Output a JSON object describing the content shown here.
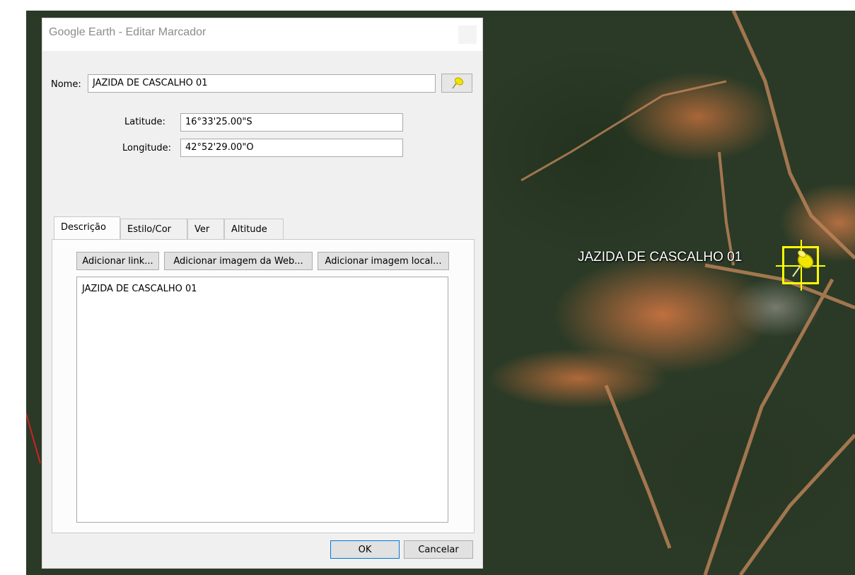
{
  "map": {
    "placemark_label": "JAZIDA DE CASCALHO 01"
  },
  "dialog": {
    "title": "Google Earth - Editar Marcador",
    "name_label": "Nome:",
    "name_value": "JAZIDA DE CASCALHO 01",
    "latitude_label": "Latitude:",
    "latitude_value": "16°33'25.00\"S",
    "longitude_label": "Longitude:",
    "longitude_value": "42°52'29.00\"O",
    "tabs": [
      {
        "label": "Descrição",
        "active": true
      },
      {
        "label": "Estilo/Cor",
        "active": false
      },
      {
        "label": "Ver",
        "active": false
      },
      {
        "label": "Altitude",
        "active": false
      }
    ],
    "add_link_label": "Adicionar link...",
    "add_web_image_label": "Adicionar imagem da Web...",
    "add_local_image_label": "Adicionar imagem local...",
    "description_text": "JAZIDA DE CASCALHO 01",
    "ok_label": "OK",
    "cancel_label": "Cancelar"
  },
  "colors": {
    "pin_yellow": "#ffff00",
    "ok_border": "#0078d7"
  }
}
